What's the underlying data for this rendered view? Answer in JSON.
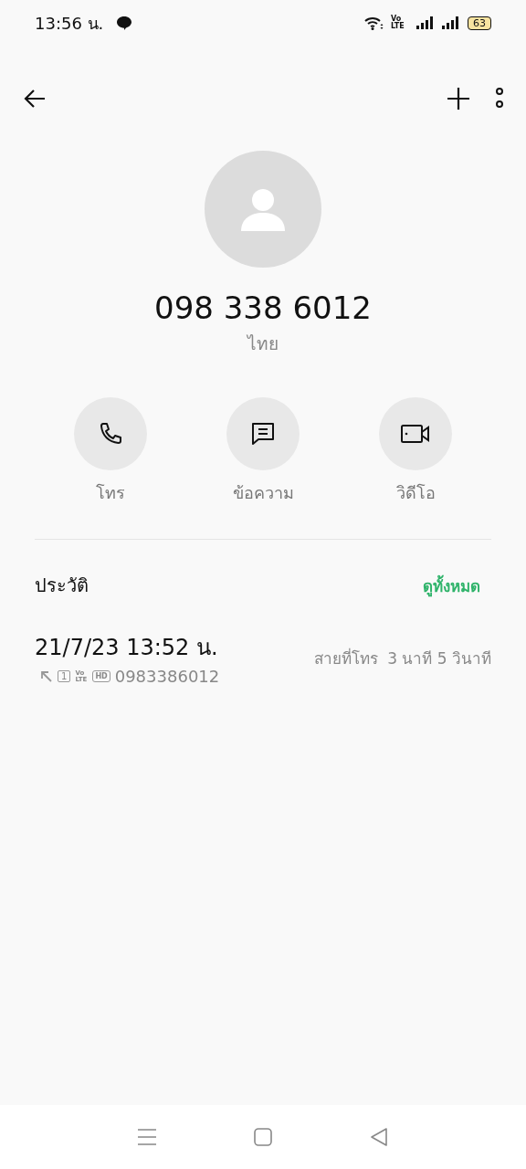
{
  "status_bar": {
    "time": "13:56 น.",
    "battery": "63",
    "volte": "Vo LTE"
  },
  "contact": {
    "number": "098 338 6012",
    "location": "ไทย"
  },
  "actions": [
    {
      "kind": "call",
      "label": "โทร"
    },
    {
      "kind": "message",
      "label": "ข้อความ"
    },
    {
      "kind": "video",
      "label": "วิดีโอ"
    }
  ],
  "history": {
    "title": "ประวัติ",
    "see_all": "ดูทั้งหมด",
    "entries": [
      {
        "datetime": "21/7/23 13:52 น.",
        "sim": "1",
        "volte": "Vo LTE",
        "hd": "HD",
        "number": "0983386012",
        "type": "สายที่โทร",
        "duration": "3 นาที 5 วินาที"
      }
    ]
  }
}
